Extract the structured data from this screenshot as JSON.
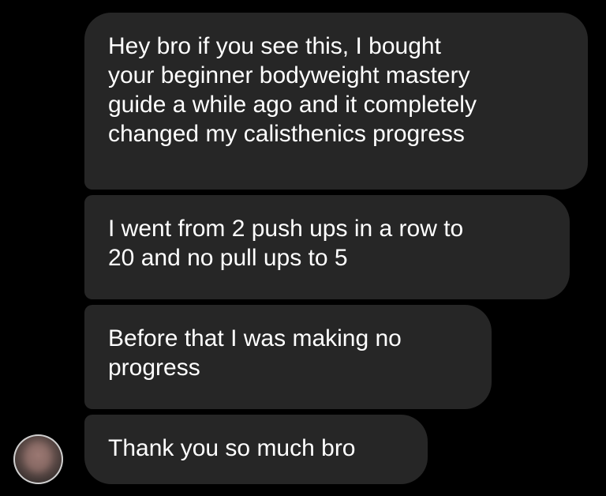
{
  "conversation": {
    "messages": [
      {
        "text": "Hey bro if you see this, I bought\nyour beginner bodyweight mastery\nguide a while ago and it completely\nchanged my calisthenics progress"
      },
      {
        "text": "I went from 2 push ups in a row to\n20 and no pull ups to 5"
      },
      {
        "text": "Before that I was making no\nprogress"
      },
      {
        "text": "Thank you so much bro"
      }
    ]
  },
  "colors": {
    "background": "#000000",
    "bubble": "#262626",
    "text": "#ffffff"
  }
}
